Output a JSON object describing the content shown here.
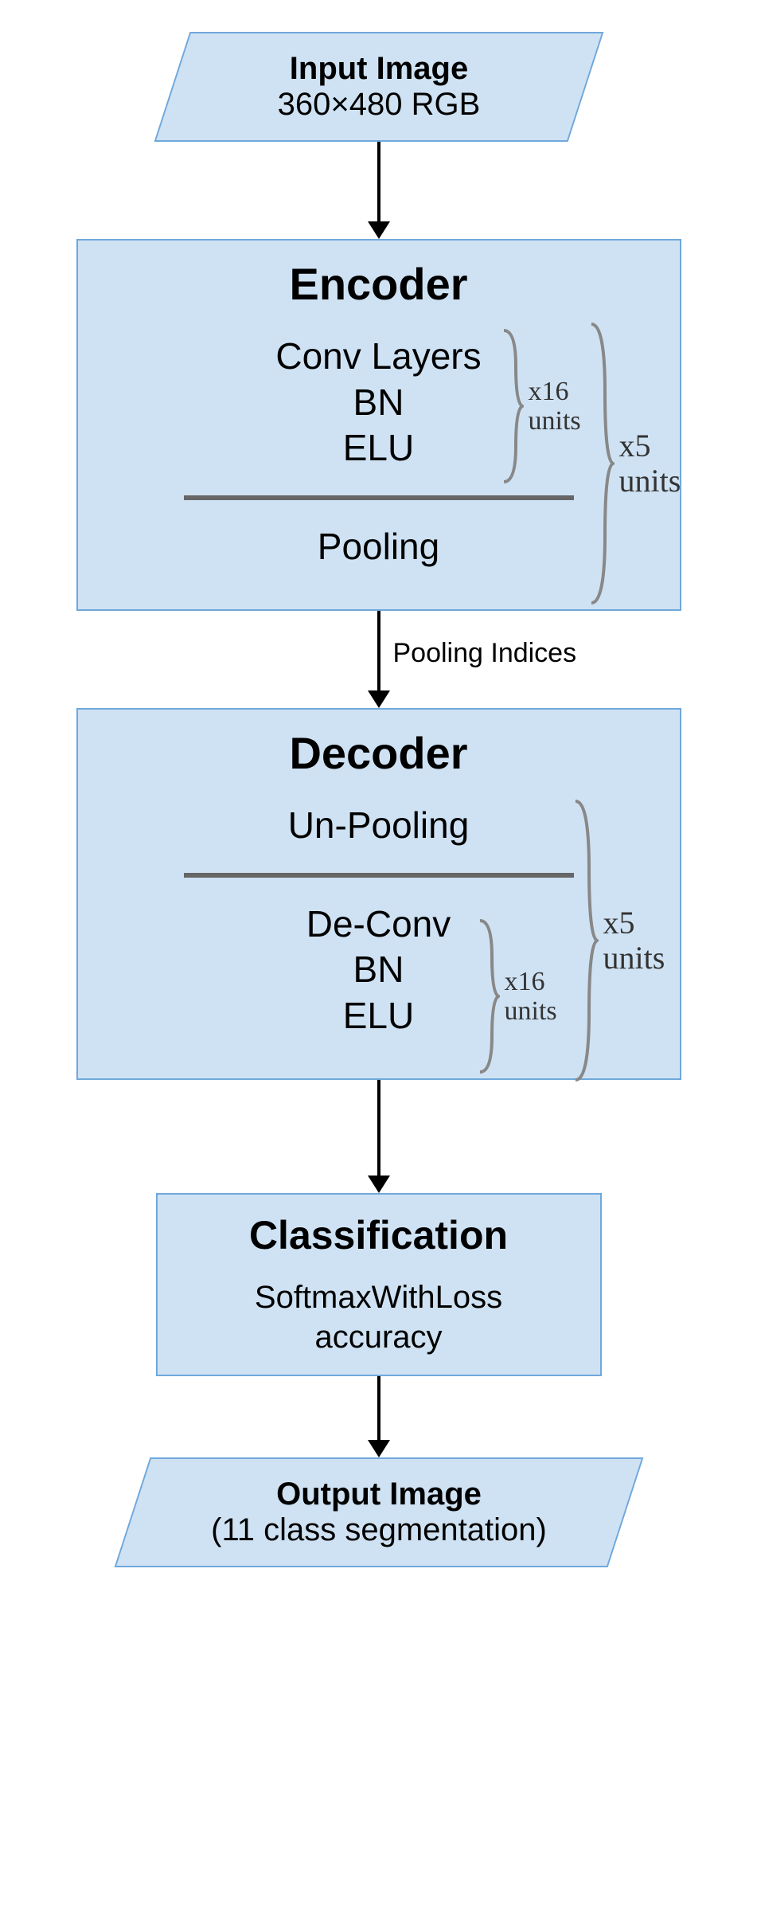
{
  "input": {
    "title": "Input Image",
    "sub": "360×480 RGB"
  },
  "encoder": {
    "heading": "Encoder",
    "l1": "Conv Layers",
    "l2": "BN",
    "l3": "ELU",
    "l4": "Pooling",
    "inner_repeat": "x16\nunits",
    "outer_repeat": "x5\nunits"
  },
  "pooling_label": "Pooling Indices",
  "decoder": {
    "heading": "Decoder",
    "l1": "Un-Pooling",
    "l2": "De-Conv",
    "l3": "BN",
    "l4": "ELU",
    "inner_repeat": "x16\nunits",
    "outer_repeat": "x5\nunits"
  },
  "classification": {
    "heading": "Classification",
    "l1": "SoftmaxWithLoss",
    "l2": "accuracy"
  },
  "output": {
    "title": "Output Image",
    "sub": "(11 class segmentation)"
  }
}
